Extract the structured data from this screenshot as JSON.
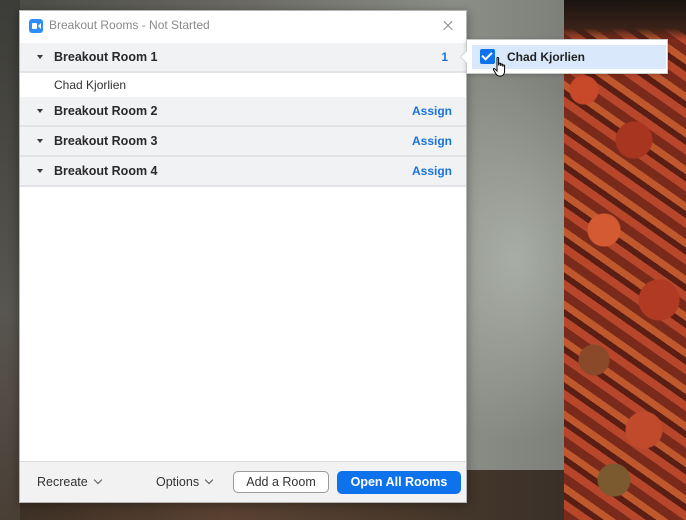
{
  "window": {
    "title": "Breakout Rooms - Not Started",
    "icon": "zoom-camera-icon",
    "close_icon": "close-icon"
  },
  "rooms": [
    {
      "name": "Breakout Room 1",
      "action": "1",
      "expanded": true,
      "members": [
        "Chad Kjorlien"
      ]
    },
    {
      "name": "Breakout Room 2",
      "action": "Assign",
      "members": []
    },
    {
      "name": "Breakout Room 3",
      "action": "Assign",
      "members": []
    },
    {
      "name": "Breakout Room 4",
      "action": "Assign",
      "members": []
    }
  ],
  "footer": {
    "recreate_label": "Recreate",
    "options_label": "Options",
    "add_room_label": "Add a Room",
    "open_all_label": "Open All Rooms"
  },
  "assign_popover": {
    "participant": "Chad Kjorlien",
    "checked": true
  },
  "colors": {
    "accent": "#0e72ed",
    "link": "#1a73d9",
    "row_bg": "#f1f2f4",
    "selected_bg": "#d9e9fb"
  }
}
